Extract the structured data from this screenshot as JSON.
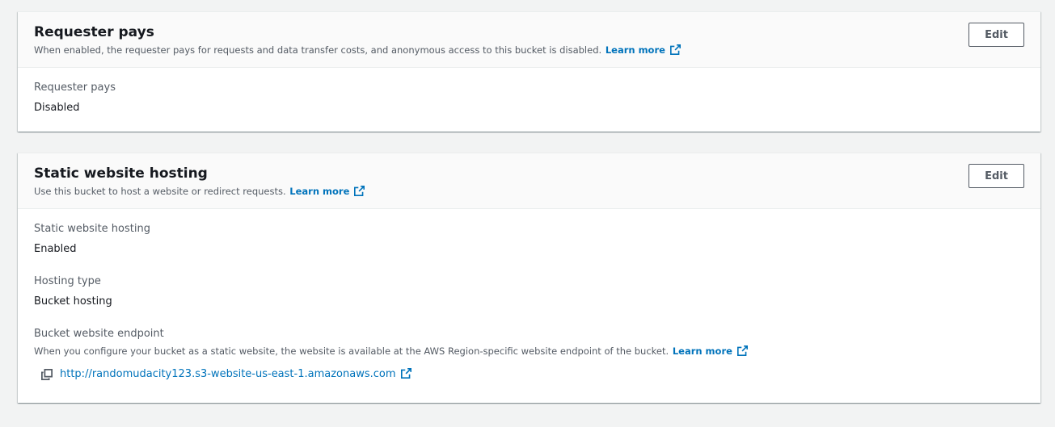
{
  "requester_pays": {
    "title": "Requester pays",
    "description": "When enabled, the requester pays for requests and data transfer costs, and anonymous access to this bucket is disabled.",
    "learn_more": "Learn more",
    "edit_label": "Edit",
    "field_label": "Requester pays",
    "field_value": "Disabled"
  },
  "static_hosting": {
    "title": "Static website hosting",
    "description": "Use this bucket to host a website or redirect requests.",
    "learn_more": "Learn more",
    "edit_label": "Edit",
    "status_label": "Static website hosting",
    "status_value": "Enabled",
    "type_label": "Hosting type",
    "type_value": "Bucket hosting",
    "endpoint_label": "Bucket website endpoint",
    "endpoint_description": "When you configure your bucket as a static website, the website is available at the AWS Region-specific website endpoint of the bucket.",
    "endpoint_learn_more": "Learn more",
    "endpoint_url": "http://randomudacity123.s3-website-us-east-1.amazonaws.com"
  },
  "icons": {
    "external_link": "external-link-icon",
    "copy": "copy-icon"
  },
  "colors": {
    "link": "#0073bb",
    "text": "#16191f",
    "secondary_text": "#545b64",
    "background": "#f2f3f3"
  }
}
